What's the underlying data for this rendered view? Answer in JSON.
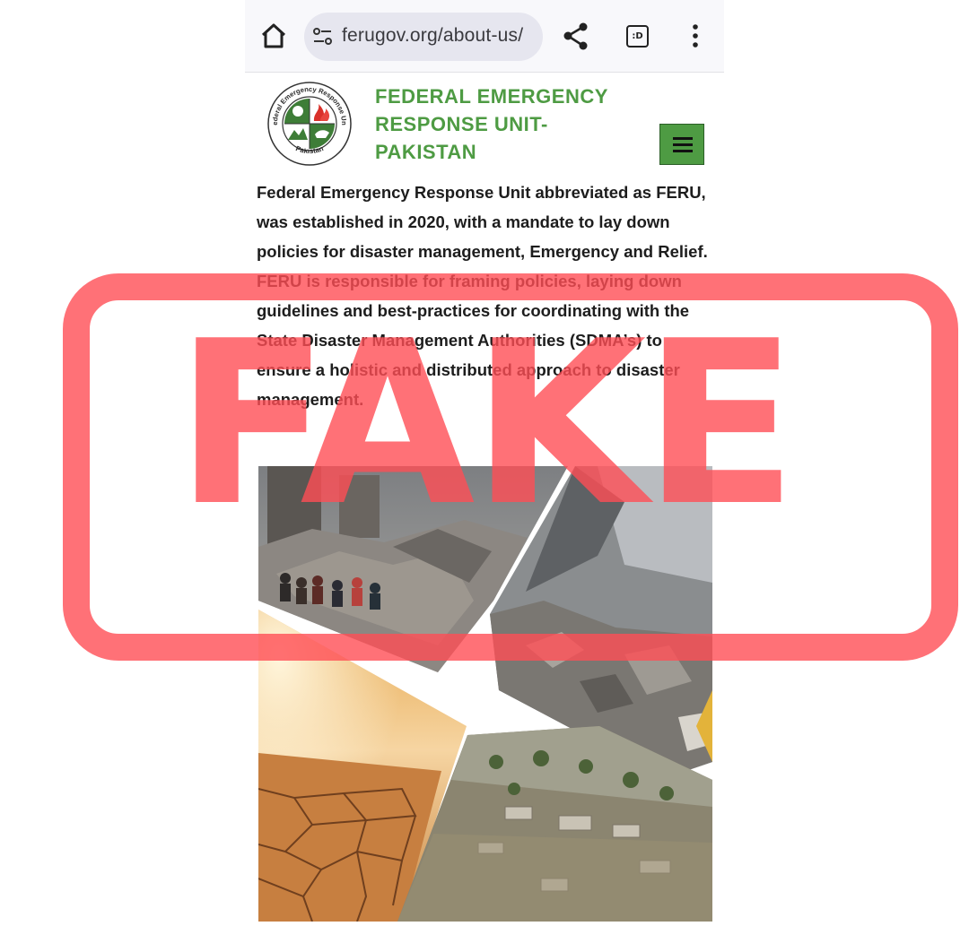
{
  "browser": {
    "url": "ferugov.org/about-us/",
    "tab_count": ":D",
    "icons": [
      "home-icon",
      "site-settings-icon",
      "share-icon",
      "tab-switcher-icon",
      "more-vert-icon"
    ]
  },
  "site": {
    "title_lines": "FEDERAL EMERGENCY\nRESPONSE UNIT-\nPAKISTAN",
    "logo": {
      "top_text": "Federal Emergency Response Unit",
      "bottom_text": "Pakistan"
    },
    "brand_color": "#4e9b43"
  },
  "about": {
    "paragraph": "Federal Emergency Response Unit abbreviated as FERU, was established in 2020, with a mandate to lay down policies for disaster management, Emergency and Relief. FERU is responsible for framing policies, laying down guidelines and best-practices for coordinating with the State Disaster Management Authorities (SDMA’s) to ensure a holistic and distributed approach to disaster management."
  },
  "collage": {
    "panels": [
      "earthquake-rubble-crowd",
      "mountain-rockfall",
      "cracked-desert",
      "flooded-village"
    ]
  },
  "overlay": {
    "stamp_text": "FAKE",
    "stamp_color": "#ff4e55"
  }
}
